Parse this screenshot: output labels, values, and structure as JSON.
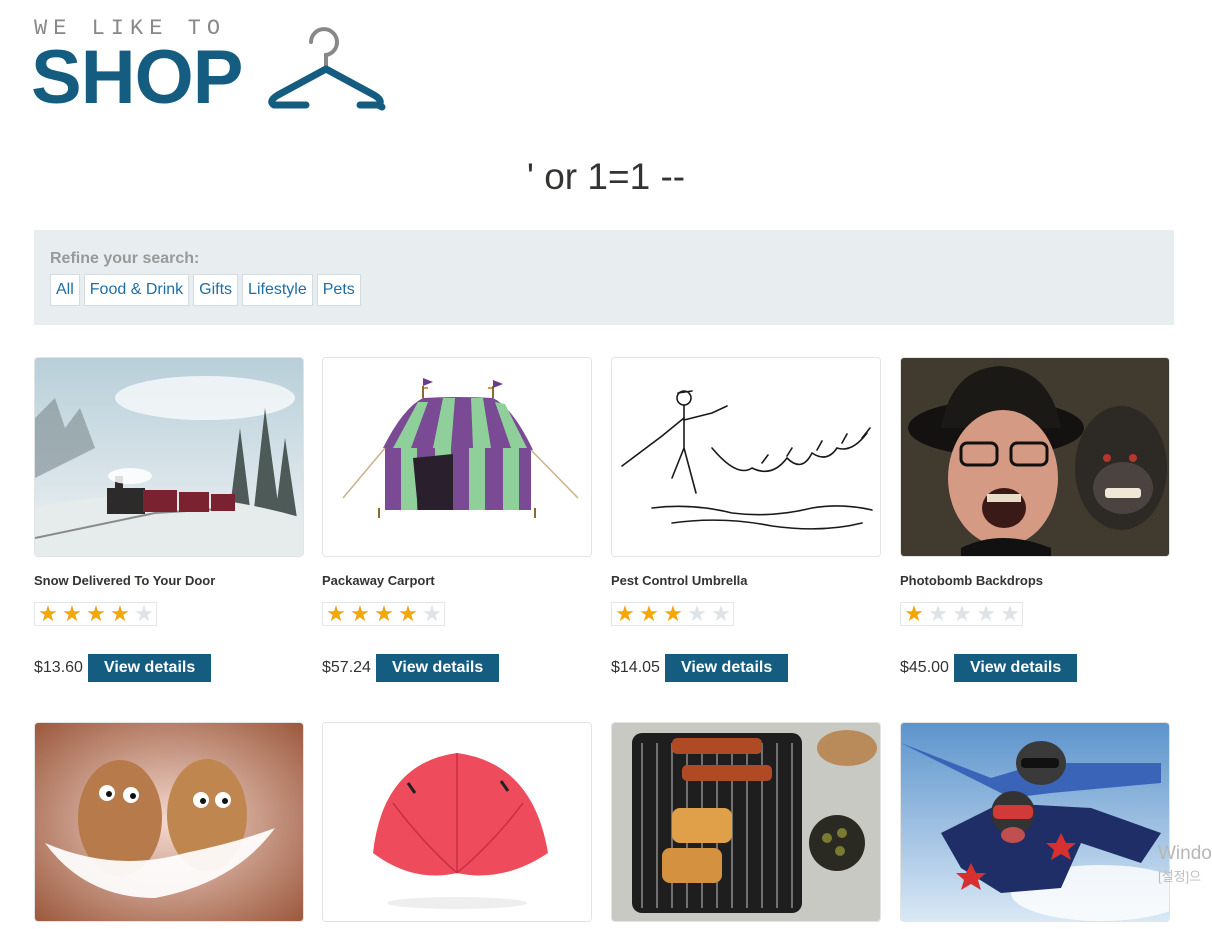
{
  "logo": {
    "tagline": "WE LIKE TO",
    "title": "SHOP"
  },
  "search_title": "' or 1=1 --",
  "filter": {
    "label": "Refine your search:",
    "links": [
      "All",
      "Food & Drink",
      "Gifts",
      "Lifestyle",
      "Pets"
    ]
  },
  "products": [
    {
      "name": "Snow Delivered To Your Door",
      "rating": 4,
      "price": "$13.60",
      "button": "View details",
      "image": "snowy-train-photo"
    },
    {
      "name": "Packaway Carport",
      "rating": 4,
      "price": "$57.24",
      "button": "View details",
      "image": "striped-tent-photo"
    },
    {
      "name": "Pest Control Umbrella",
      "rating": 3,
      "price": "$14.05",
      "button": "View details",
      "image": "umbrella-cats-sketch"
    },
    {
      "name": "Photobomb Backdrops",
      "rating": 1,
      "price": "$45.00",
      "button": "View details",
      "image": "man-and-monkey-photo"
    },
    {
      "image": "eggs-with-feathers-photo"
    },
    {
      "image": "red-umbrella-tent-photo"
    },
    {
      "image": "grill-skewers-photo"
    },
    {
      "image": "skydivers-photo"
    }
  ],
  "overlay": {
    "line1": "Windo",
    "line2": "[설정]으"
  },
  "colors": {
    "brand": "#155d80",
    "star": "#f2a705",
    "link": "#1e6ea6",
    "panel": "#e8edf0"
  }
}
